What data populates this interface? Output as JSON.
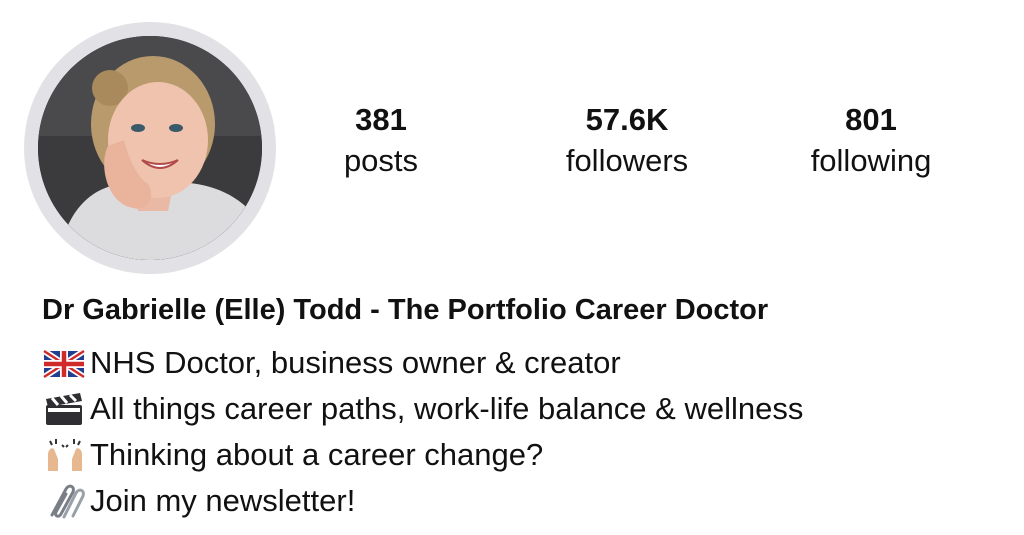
{
  "profile": {
    "stats": [
      {
        "count": "381",
        "label": "posts"
      },
      {
        "count": "57.6K",
        "label": "followers"
      },
      {
        "count": "801",
        "label": "following"
      }
    ],
    "name": "Dr Gabrielle (Elle) Todd - The Portfolio Career Doctor",
    "bio": [
      {
        "icon": "uk-flag-icon",
        "text": "NHS Doctor, business owner & creator"
      },
      {
        "icon": "clapperboard-icon",
        "text": "All things career paths, work-life balance & wellness"
      },
      {
        "icon": "raising-hands-icon",
        "text": "Thinking about a career change?"
      },
      {
        "icon": "paperclips-icon",
        "text": "Join my newsletter!"
      }
    ]
  },
  "colors": {
    "text": "#111111",
    "avatar_ring": "#e2e2e6",
    "background": "#ffffff"
  }
}
